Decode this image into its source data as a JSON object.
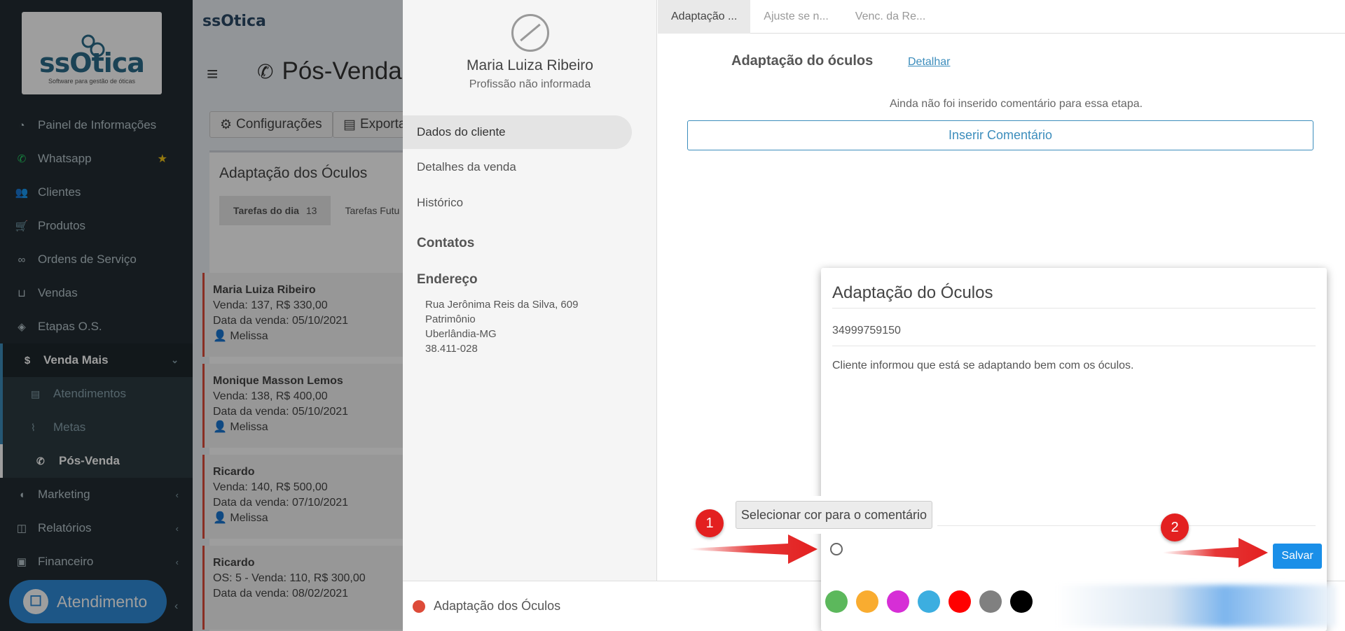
{
  "brand": {
    "logo_word": "ssOtica",
    "logo_tagline": "Software para gestão de óticas",
    "topbar_logo": "ssOtica"
  },
  "sidebar": {
    "items": [
      {
        "label": "Painel de Informações",
        "icon": "dashboard-icon"
      },
      {
        "label": "Whatsapp",
        "icon": "whatsapp-icon",
        "starred": true
      },
      {
        "label": "Clientes",
        "icon": "users-icon"
      },
      {
        "label": "Produtos",
        "icon": "cart-icon"
      },
      {
        "label": "Ordens de Serviço",
        "icon": "glasses-icon"
      },
      {
        "label": "Vendas",
        "icon": "basket-icon"
      },
      {
        "label": "Etapas O.S.",
        "icon": "tag-icon"
      },
      {
        "label": "Venda Mais",
        "icon": "dollar-icon"
      }
    ],
    "venda_mais_sub": [
      {
        "label": "Atendimentos",
        "icon": "clipboard-icon"
      },
      {
        "label": "Metas",
        "icon": "chart-line-icon"
      },
      {
        "label": "Pós-Venda",
        "icon": "phone-icon"
      }
    ],
    "items_after": [
      {
        "label": "Marketing",
        "icon": "bullhorn-icon"
      },
      {
        "label": "Relatórios",
        "icon": "reports-icon"
      },
      {
        "label": "Financeiro",
        "icon": "money-icon"
      }
    ],
    "atendimento_label": "Atendimento"
  },
  "page": {
    "title": "Pós-Venda",
    "config_label": "Configurações",
    "export_label": "Exportar",
    "box_title": "Adaptação dos Óculos",
    "tab_today": "Tarefas do dia",
    "tab_today_count": "13",
    "tab_future": "Tarefas Futu"
  },
  "cards": [
    {
      "name": "Maria Luiza Ribeiro",
      "line1": "Venda: 137, R$ 330,00",
      "line2": "Data da venda: 05/10/2021",
      "line3": "Melissa"
    },
    {
      "name": "Monique Masson Lemos",
      "line1": "Venda: 138, R$ 400,00",
      "line2": "Data da venda: 05/10/2021",
      "line3": "Melissa"
    },
    {
      "name": "Ricardo",
      "line1": "Venda: 140, R$ 500,00",
      "line2": "Data da venda: 07/10/2021",
      "line3": "Melissa"
    },
    {
      "name": "Ricardo",
      "line1": "OS: 5 - Venda: 110, R$ 300,00",
      "line2": "Data da venda: 08/02/2021",
      "line3": ""
    }
  ],
  "client": {
    "name": "Maria Luiza Ribeiro",
    "profession": "Profissão não informada",
    "links": [
      "Dados do cliente",
      "Detalhes da venda",
      "Histórico"
    ],
    "contacts_heading": "Contatos",
    "address_heading": "Endereço",
    "address": [
      "Rua Jerônima Reis da Silva, 609",
      "Patrimônio",
      "Uberlândia-MG",
      "38.411-028"
    ]
  },
  "stages": {
    "tabs": [
      "Adaptação ...",
      "Ajuste se n...",
      "Venc. da Re..."
    ],
    "title": "Adaptação do óculos",
    "detail_link": "Detalhar",
    "no_comment": "Ainda não foi inserido comentário para essa etapa.",
    "insert_button": "Inserir Comentário"
  },
  "footer": {
    "stage_label": "Adaptação dos Óculos",
    "stage_color": "#dd4b39"
  },
  "modal": {
    "title": "Adaptação do Óculos",
    "phone": "34999759150",
    "comment": "Cliente informou que está se adaptando bem com os óculos.",
    "save_label": "Salvar",
    "tooltip": "Selecionar cor para o comentário",
    "palette": [
      "#5cb85c",
      "#f9ac30",
      "#d62ed6",
      "#3caee0",
      "#ff0000",
      "#808080",
      "#000000"
    ]
  },
  "annotations": {
    "step1": "1",
    "step2": "2",
    "color": "#e32020"
  }
}
